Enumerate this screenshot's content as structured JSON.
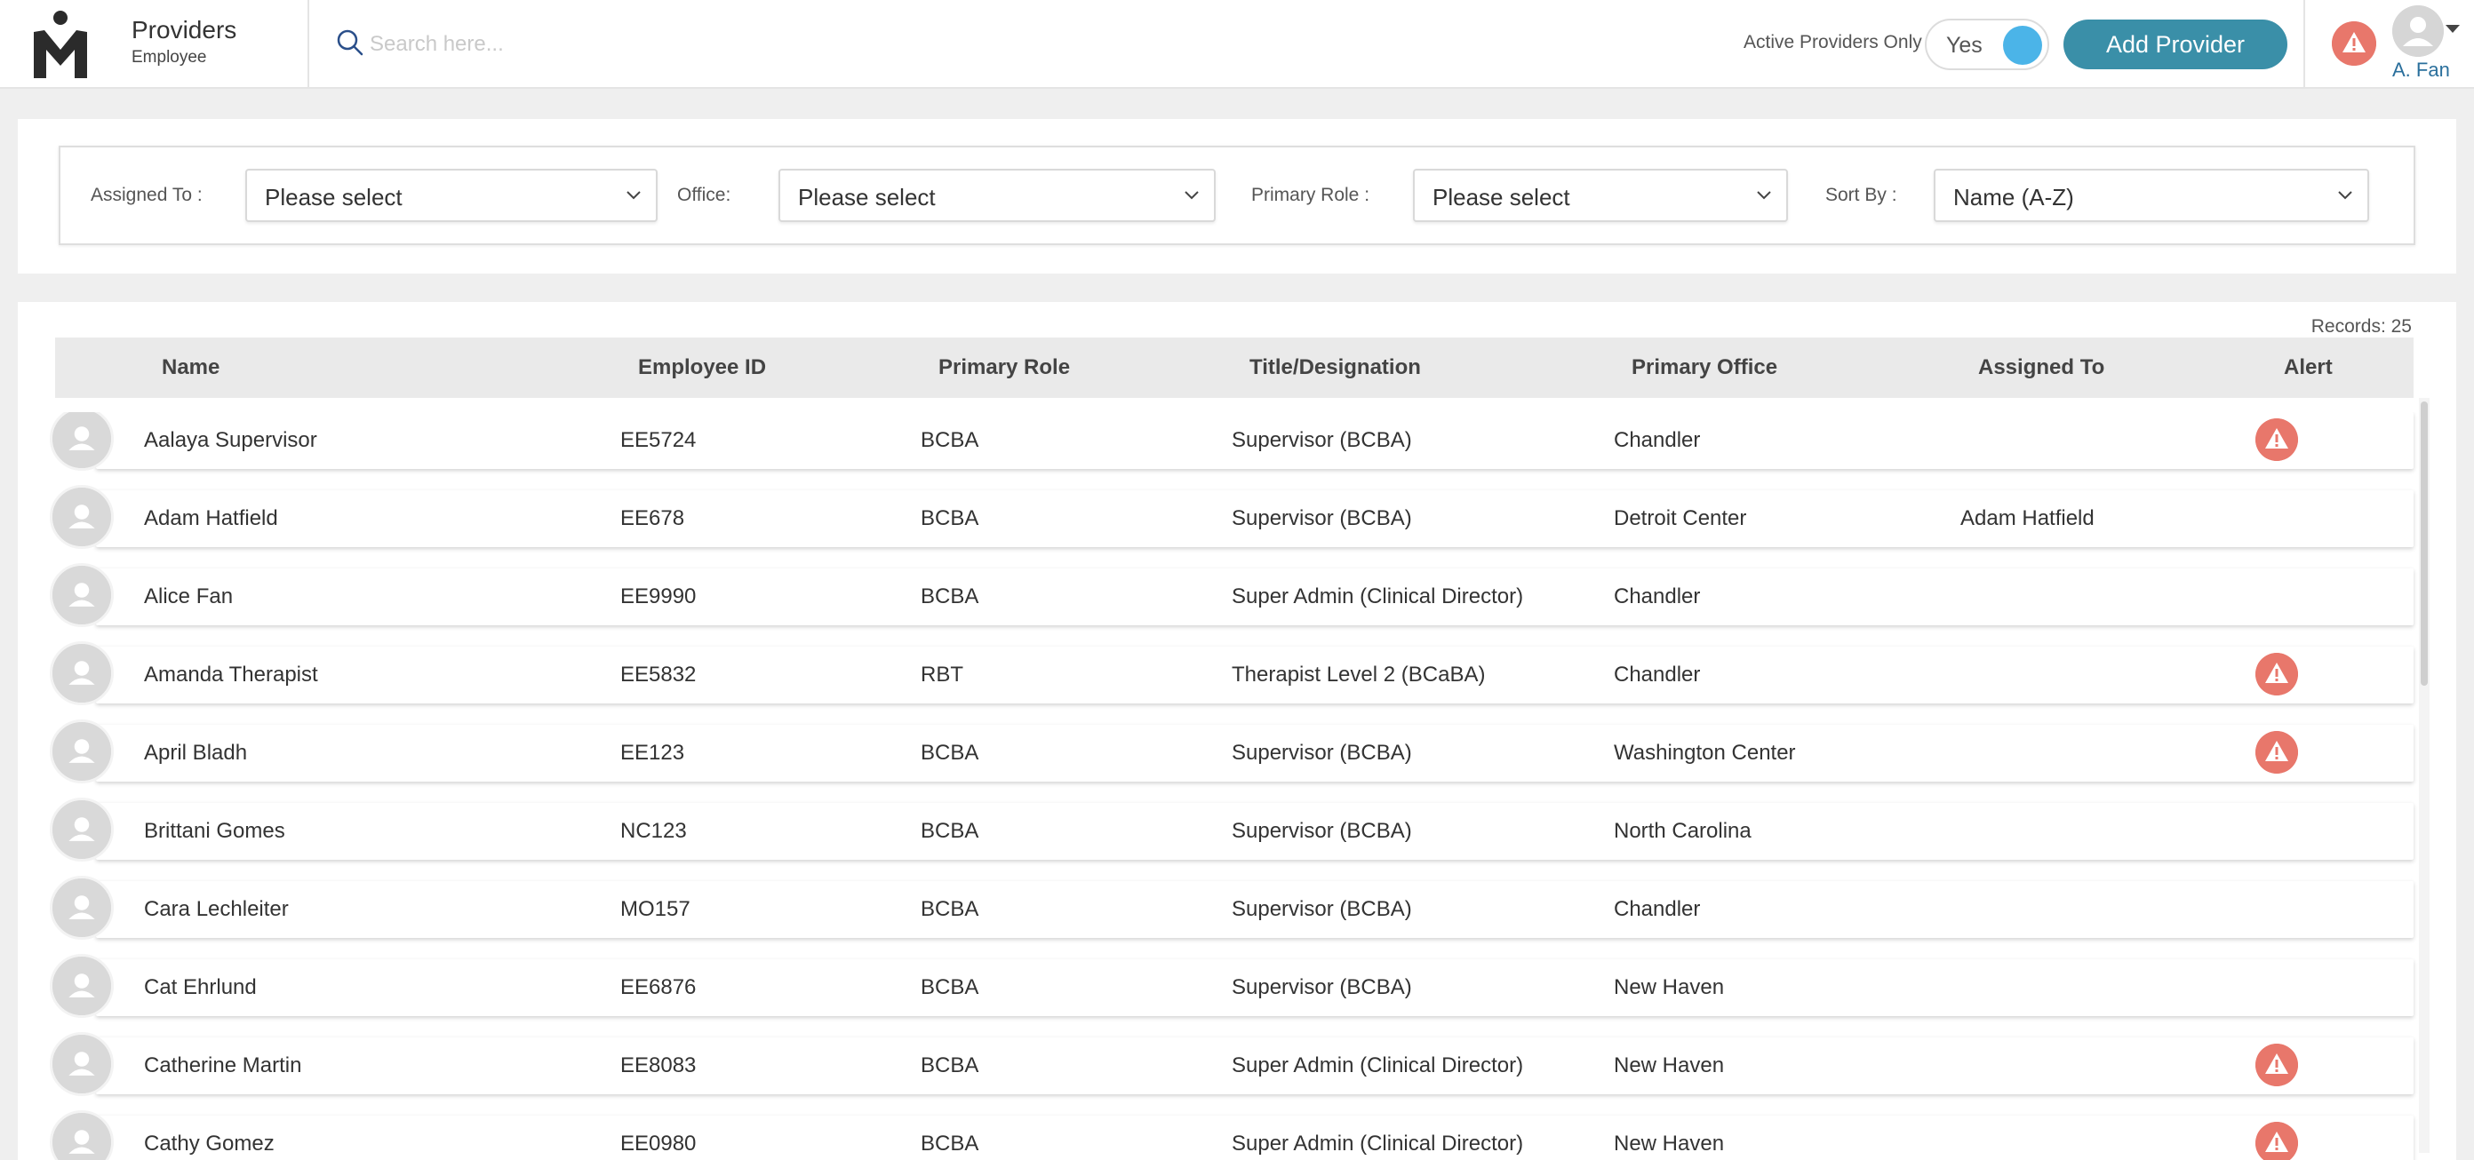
{
  "header": {
    "title": "Providers",
    "subtitle": "Employee",
    "search_placeholder": "Search here...",
    "active_only_label": "Active Providers Only",
    "toggle_value": "Yes",
    "add_button": "Add Provider",
    "user_name": "A. Fan",
    "colors": {
      "accent": "#3a8fa8",
      "toggle": "#4bb4e8",
      "alert": "#e8776b",
      "user": "#2a6f9c"
    }
  },
  "filters": {
    "assigned_label": "Assigned To :",
    "assigned_value": "Please select",
    "office_label": "Office:",
    "office_value": "Please select",
    "role_label": "Primary Role :",
    "role_value": "Please select",
    "sort_label": "Sort By :",
    "sort_value": "Name (A-Z)"
  },
  "table": {
    "records": "Records:  25",
    "columns": [
      "Name",
      "Employee ID",
      "Primary Role",
      "Title/Designation",
      "Primary Office",
      "Assigned To",
      "Alert"
    ],
    "rows": [
      {
        "name": "Aalaya Supervisor",
        "id": "EE5724",
        "role": "BCBA",
        "title": "Supervisor (BCBA)",
        "office": "Chandler",
        "assigned": "",
        "alert": true
      },
      {
        "name": "Adam Hatfield",
        "id": "EE678",
        "role": "BCBA",
        "title": "Supervisor (BCBA)",
        "office": "Detroit Center",
        "assigned": "Adam Hatfield",
        "alert": false
      },
      {
        "name": "Alice Fan",
        "id": "EE9990",
        "role": "BCBA",
        "title": "Super Admin (Clinical Director)",
        "office": "Chandler",
        "assigned": "",
        "alert": false
      },
      {
        "name": "Amanda Therapist",
        "id": "EE5832",
        "role": "RBT",
        "title": "Therapist Level 2 (BCaBA)",
        "office": "Chandler",
        "assigned": "",
        "alert": true
      },
      {
        "name": "April Bladh",
        "id": "EE123",
        "role": "BCBA",
        "title": "Supervisor (BCBA)",
        "office": "Washington Center",
        "assigned": "",
        "alert": true
      },
      {
        "name": "Brittani Gomes",
        "id": "NC123",
        "role": "BCBA",
        "title": "Supervisor (BCBA)",
        "office": "North Carolina",
        "assigned": "",
        "alert": false
      },
      {
        "name": "Cara Lechleiter",
        "id": "MO157",
        "role": "BCBA",
        "title": "Supervisor (BCBA)",
        "office": "Chandler",
        "assigned": "",
        "alert": false
      },
      {
        "name": "Cat Ehrlund",
        "id": "EE6876",
        "role": "BCBA",
        "title": "Supervisor (BCBA)",
        "office": "New Haven",
        "assigned": "",
        "alert": false
      },
      {
        "name": "Catherine Martin",
        "id": "EE8083",
        "role": "BCBA",
        "title": "Super Admin (Clinical Director)",
        "office": "New Haven",
        "assigned": "",
        "alert": true
      },
      {
        "name": "Cathy Gomez",
        "id": "EE0980",
        "role": "BCBA",
        "title": "Super Admin (Clinical Director)",
        "office": "New Haven",
        "assigned": "",
        "alert": true
      }
    ]
  }
}
